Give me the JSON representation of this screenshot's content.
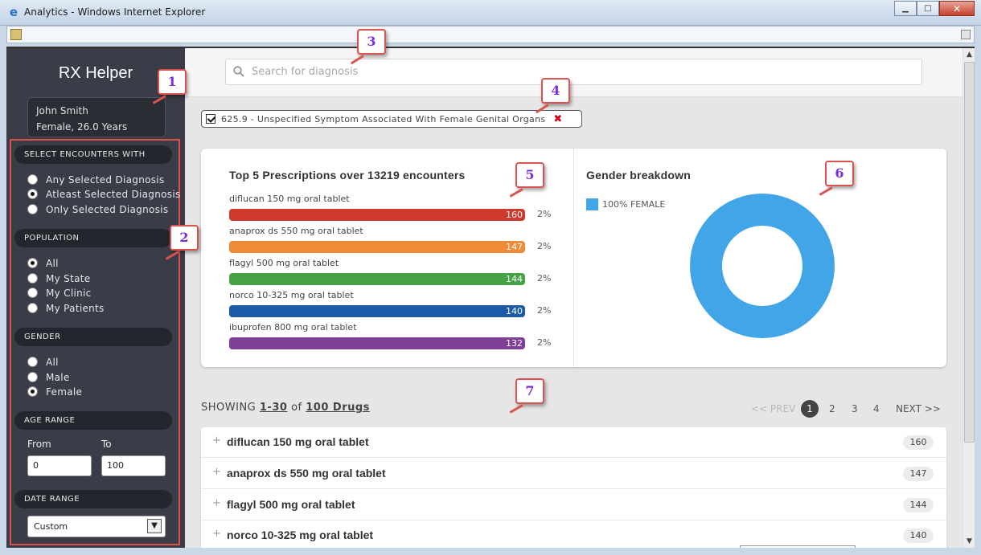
{
  "window": {
    "title": "Analytics - Windows Internet Explorer"
  },
  "sidebar": {
    "app_title": "RX Helper",
    "user": {
      "name": "John Smith",
      "details": "Female, 26.0 Years"
    },
    "encounters": {
      "header": "SELECT ENCOUNTERS WITH",
      "options": [
        "Any Selected Diagnosis",
        "Atleast Selected Diagnosis",
        "Only Selected Diagnosis"
      ],
      "selected": "Atleast Selected Diagnosis"
    },
    "population": {
      "header": "POPULATION",
      "options": [
        "All",
        "My State",
        "My Clinic",
        "My Patients"
      ],
      "selected": "All"
    },
    "gender": {
      "header": "GENDER",
      "options": [
        "All",
        "Male",
        "Female"
      ],
      "selected": "Female"
    },
    "age_range": {
      "header": "AGE RANGE",
      "from_label": "From",
      "to_label": "To",
      "from_value": "0",
      "to_value": "100"
    },
    "date_range": {
      "header": "DATE RANGE",
      "value": "Custom"
    }
  },
  "search": {
    "placeholder": "Search for diagnosis"
  },
  "diagnosis_chip": {
    "label": "625.9 - Unspecified Symptom Associated With Female Genital Organs"
  },
  "prescriptions": {
    "title": "Top 5 Prescriptions over 13219 encounters",
    "items": [
      {
        "name": "diflucan 150 mg oral tablet",
        "count": "160",
        "pct": "2%",
        "color": "#cf3a2f"
      },
      {
        "name": "anaprox ds 550 mg oral tablet",
        "count": "147",
        "pct": "2%",
        "color": "#ef8b36"
      },
      {
        "name": "flagyl 500 mg oral tablet",
        "count": "144",
        "pct": "2%",
        "color": "#45a345"
      },
      {
        "name": "norco 10-325 mg oral tablet",
        "count": "140",
        "pct": "2%",
        "color": "#1c5aa8"
      },
      {
        "name": "ibuprofen 800 mg oral tablet",
        "count": "132",
        "pct": "2%",
        "color": "#7e3f96"
      }
    ]
  },
  "gender_breakdown": {
    "title": "Gender breakdown",
    "legend": "100% FEMALE",
    "female_fraction": 1.0,
    "color": "#42a5e8"
  },
  "pagination": {
    "showing_prefix": "SHOWING",
    "range": "1-30",
    "of_word": "of",
    "total": "100 Drugs",
    "prev": "<< PREV",
    "pages": [
      "1",
      "2",
      "3",
      "4"
    ],
    "current": "1",
    "next": "NEXT >>"
  },
  "drug_list": [
    {
      "name": "diflucan 150 mg oral tablet",
      "count": "160"
    },
    {
      "name": "anaprox ds 550 mg oral tablet",
      "count": "147"
    },
    {
      "name": "flagyl 500 mg oral tablet",
      "count": "144"
    },
    {
      "name": "norco 10-325 mg oral tablet",
      "count": "140"
    }
  ],
  "annotations": [
    "1",
    "2",
    "3",
    "4",
    "5",
    "6",
    "7"
  ]
}
